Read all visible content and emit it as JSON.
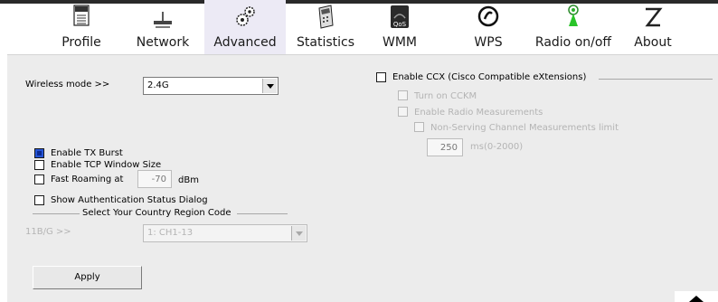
{
  "toolbar": {
    "items": [
      {
        "label": "Profile",
        "icon": "profile-icon"
      },
      {
        "label": "Network",
        "icon": "network-icon"
      },
      {
        "label": "Advanced",
        "icon": "gears-icon",
        "active": true
      },
      {
        "label": "Statistics",
        "icon": "calculator-icon"
      },
      {
        "label": "WMM",
        "icon": "qos-icon"
      },
      {
        "label": "WPS",
        "icon": "wps-icon"
      },
      {
        "label": "Radio on/off",
        "icon": "radio-icon"
      },
      {
        "label": "About",
        "icon": "about-icon"
      }
    ],
    "qos_text": "QoS"
  },
  "wireless": {
    "label": "Wireless mode >>",
    "value": "2.4G"
  },
  "ccx": {
    "enable_label": "Enable CCX (Cisco Compatible eXtensions)",
    "ccm_label": "Turn on CCKM",
    "radio_label": "Enable Radio Measurements",
    "nonserving_label": "Non-Serving Channel Measurements limit",
    "limit_value": "250",
    "limit_unit": "ms(0-2000)"
  },
  "options": {
    "tx_burst": "Enable TX Burst",
    "tcp_window": "Enable TCP Window Size",
    "fast_roaming": "Fast Roaming at",
    "fast_roaming_value": "-70",
    "fast_roaming_unit": "dBm",
    "auth_dialog": "Show Authentication Status Dialog"
  },
  "region": {
    "title": "Select Your Country Region Code",
    "label": "11B/G >>",
    "value": "1: CH1-13"
  },
  "apply_label": "Apply"
}
